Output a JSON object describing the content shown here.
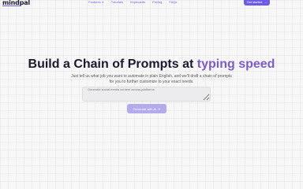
{
  "nav": {
    "logo": "mindpal",
    "links": [
      {
        "label": "Features",
        "dropdown": true
      },
      {
        "label": "Tutorials",
        "dropdown": false
      },
      {
        "label": "Keyboards",
        "dropdown": false
      },
      {
        "label": "Pricing",
        "dropdown": false
      },
      {
        "label": "FAQs",
        "dropdown": false
      }
    ],
    "cta_label": "Get started",
    "cta_icon": "arrow-right-icon"
  },
  "hero": {
    "title_main": "Build a Chain of Prompts at ",
    "title_accent": "typing speed",
    "subtitle": "Just tell us what job you want to automate in plain English, and we'll draft a chain of prompts for you to further customize to your exact needs."
  },
  "prompt": {
    "placeholder": "Generate social media content across platforms"
  },
  "generate": {
    "label": "Generate with AI",
    "icon": "sparkle-icon"
  },
  "colors": {
    "accent": "#6b5ce7",
    "title_accent": "#7b5cc9",
    "button_light": "#b3abeb"
  }
}
